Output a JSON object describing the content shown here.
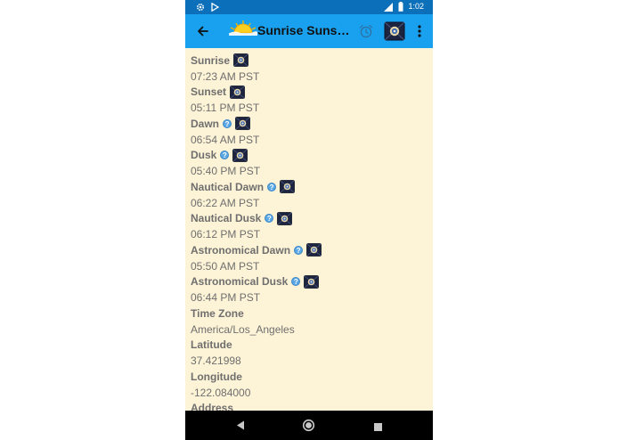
{
  "status_bar": {
    "time": "1:02",
    "network": "LTE",
    "icons": [
      "settings-icon",
      "play-store-icon",
      "signal-icon",
      "battery-icon"
    ]
  },
  "app_bar": {
    "title": "Sunrise Sunset Times",
    "icons": [
      "back-arrow-icon",
      "sunrise-logo-icon",
      "alarm-icon",
      "night-sky-icon",
      "more-vert-icon"
    ]
  },
  "details": [
    {
      "label": "Sunrise",
      "value": "07:23 AM PST",
      "help": false,
      "sky": true
    },
    {
      "label": "Sunset",
      "value": "05:11 PM PST",
      "help": false,
      "sky": true
    },
    {
      "label": "Dawn",
      "value": "06:54 AM PST",
      "help": true,
      "sky": true
    },
    {
      "label": "Dusk",
      "value": "05:40 PM PST",
      "help": true,
      "sky": true
    },
    {
      "label": "Nautical Dawn",
      "value": "06:22 AM PST",
      "help": true,
      "sky": true
    },
    {
      "label": "Nautical Dusk",
      "value": "06:12 PM PST",
      "help": true,
      "sky": true
    },
    {
      "label": "Astronomical Dawn",
      "value": "05:50 AM PST",
      "help": true,
      "sky": true
    },
    {
      "label": "Astronomical Dusk",
      "value": "06:44 PM PST",
      "help": true,
      "sky": true
    },
    {
      "label": "Time Zone",
      "value": "America/Los_Angeles",
      "help": false,
      "sky": false
    },
    {
      "label": "Latitude",
      "value": "37.421998",
      "help": false,
      "sky": false
    },
    {
      "label": "Longitude",
      "value": "-122.084000",
      "help": false,
      "sky": false
    },
    {
      "label": "Address",
      "value": "",
      "help": false,
      "sky": false
    }
  ],
  "colors": {
    "status_bar": "#0b6fb9",
    "app_bar": "#19a0ee",
    "content_bg": "#fdf3d6",
    "text": "#6f6f6f",
    "nav_bar": "#000000"
  }
}
